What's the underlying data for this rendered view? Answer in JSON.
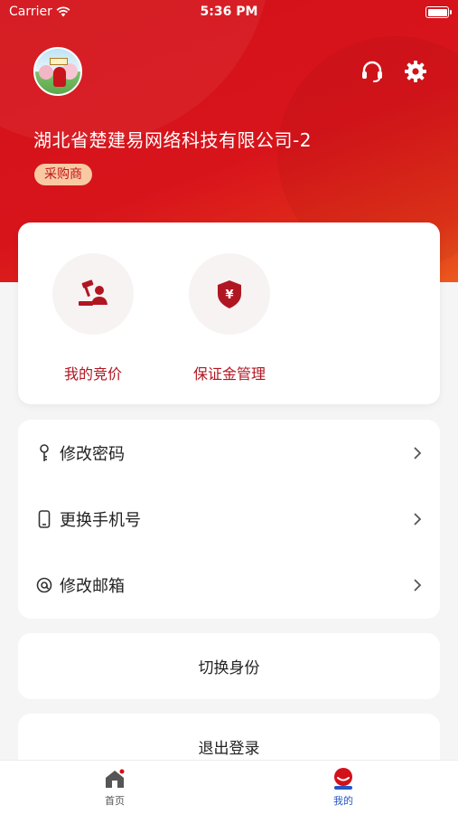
{
  "status_bar": {
    "carrier": "Carrier",
    "time": "5:36 PM"
  },
  "profile": {
    "company_name": "湖北省楚建易网络科技有限公司-2",
    "role": "采购商"
  },
  "header_icons": [
    "headset-icon",
    "gear-icon"
  ],
  "quick_actions": [
    {
      "label": "我的竞价",
      "icon": "bidding-icon"
    },
    {
      "label": "保证金管理",
      "icon": "deposit-shield-icon"
    }
  ],
  "settings": [
    {
      "label": "修改密码",
      "icon": "key-icon"
    },
    {
      "label": "更换手机号",
      "icon": "phone-icon"
    },
    {
      "label": "修改邮箱",
      "icon": "at-icon"
    }
  ],
  "actions": {
    "switch_identity": "切换身份",
    "logout": "退出登录"
  },
  "tabs": [
    {
      "label": "首页",
      "icon": "home-icon",
      "active": false
    },
    {
      "label": "我的",
      "icon": "user-icon",
      "active": true
    }
  ],
  "colors": {
    "brand_red": "#d3111a",
    "accent_text": "#b01621",
    "badge_bg": "#f9c9a3",
    "active_tab": "#2456c7"
  }
}
